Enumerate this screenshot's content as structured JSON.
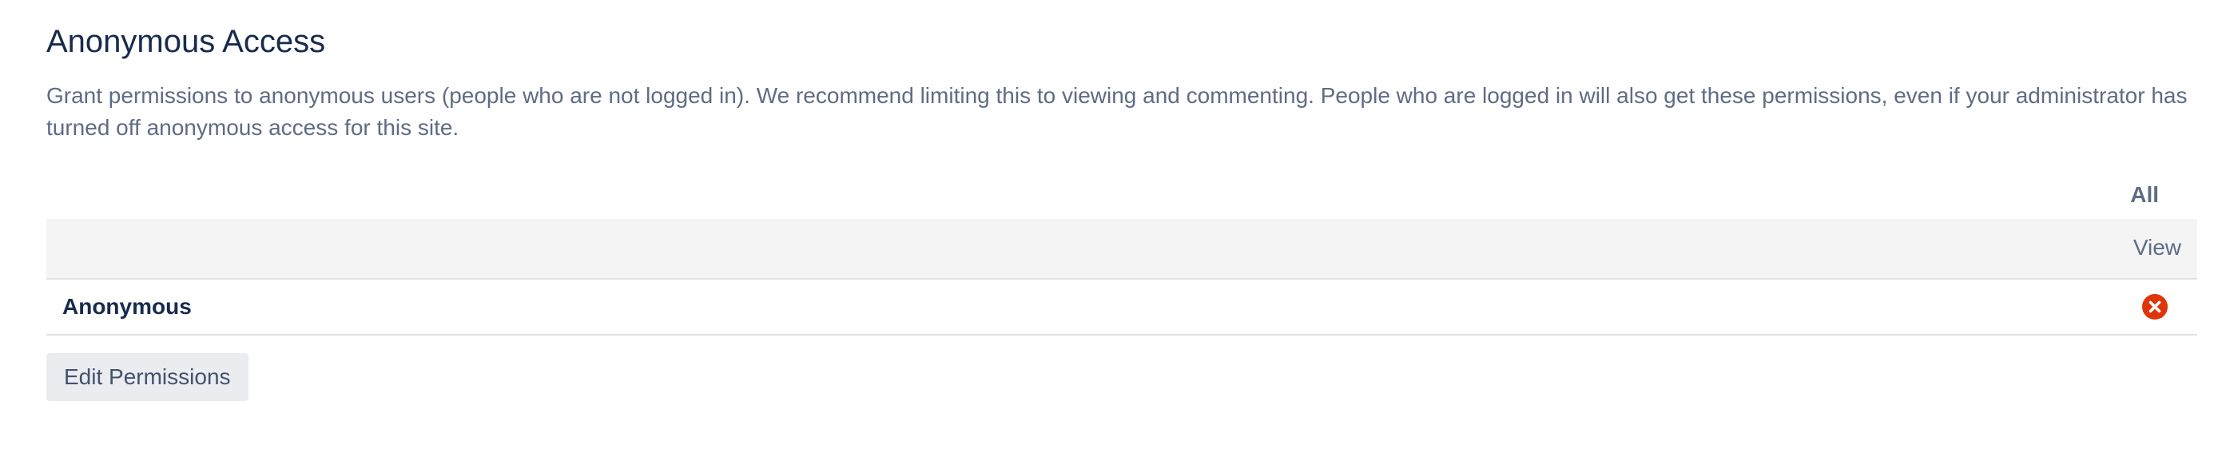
{
  "section": {
    "title": "Anonymous Access",
    "description": "Grant permissions to anonymous users (people who are not logged in). We recommend limiting this to viewing and commenting. People who are logged in will also get these permissions, even if your administrator has turned off anonymous access for this site."
  },
  "table": {
    "group_header": "All",
    "column_header": "View",
    "rows": [
      {
        "name": "Anonymous",
        "view_permission": "denied",
        "status_icon": "cross-circle-icon"
      }
    ]
  },
  "actions": {
    "edit_label": "Edit Permissions"
  },
  "colors": {
    "title": "#172b4d",
    "text_muted": "#5e6c84",
    "header_bg": "#f4f4f4",
    "denied": "#de350b",
    "button_bg": "#ebecf0"
  }
}
